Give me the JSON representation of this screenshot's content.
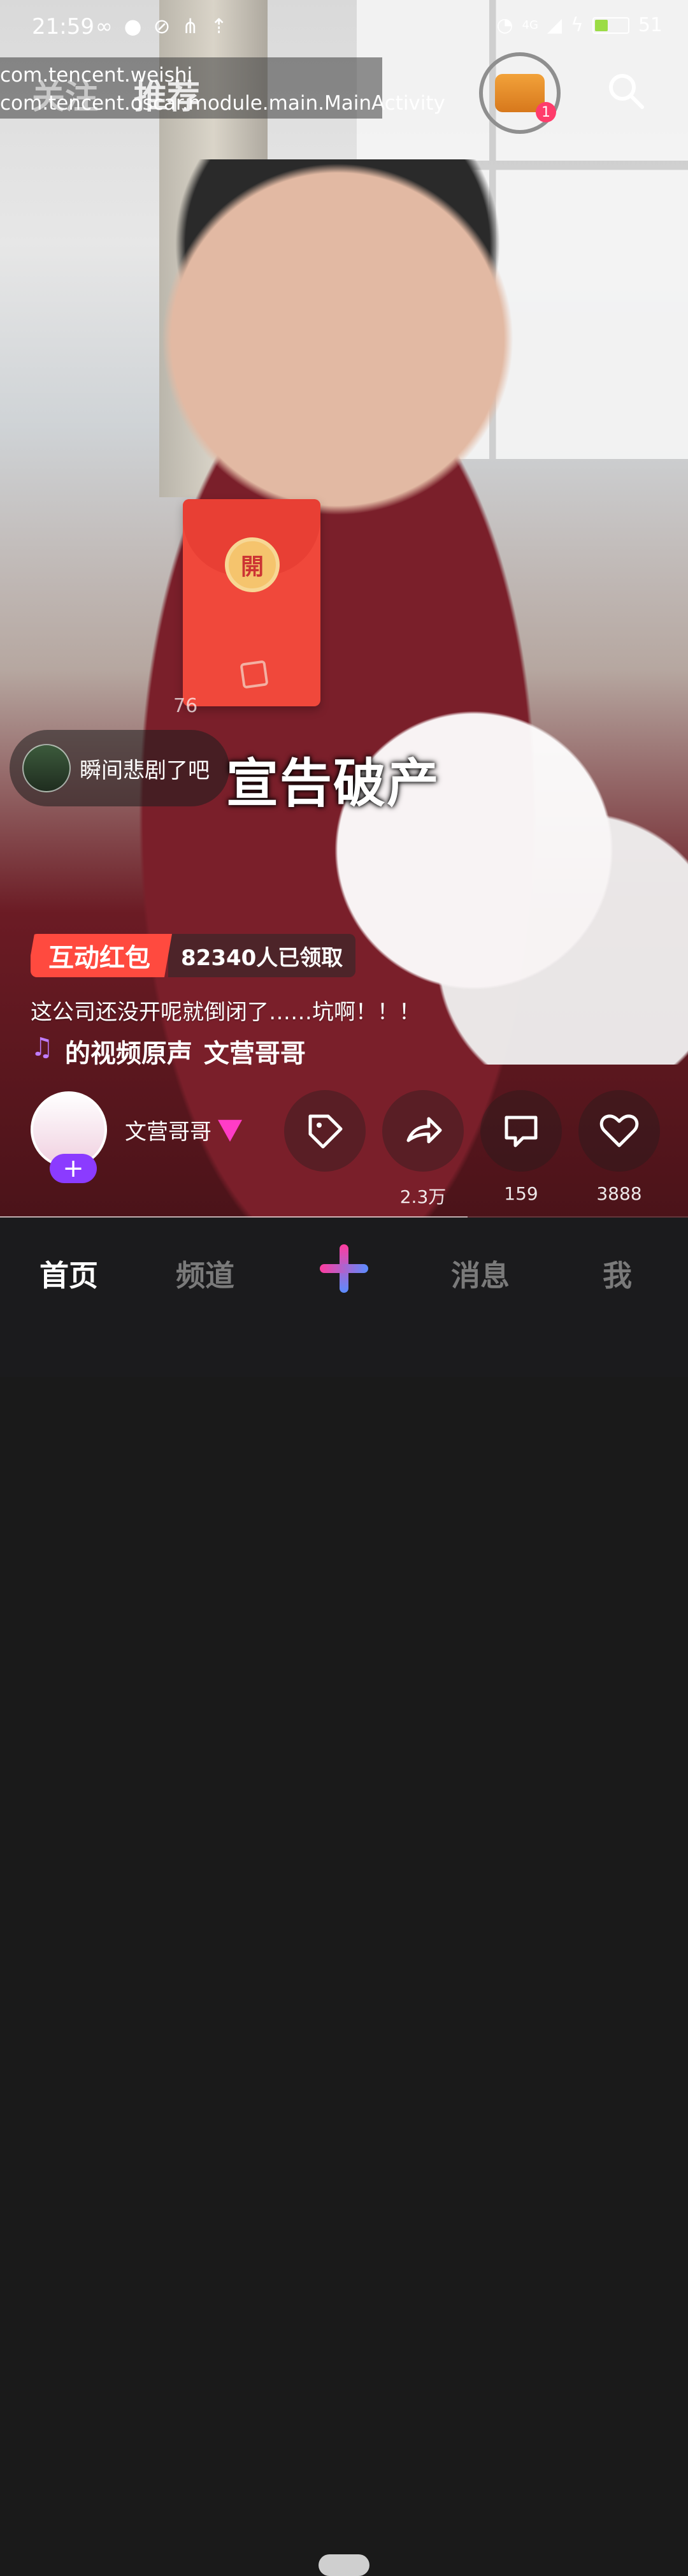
{
  "status": {
    "time": "21:59",
    "battery_level": "51",
    "network": "4G"
  },
  "debug_overlay": {
    "package": "com.tencent.weishi",
    "activity": "com.tencent.oscar.module.main.MainActivity"
  },
  "top_tabs": {
    "follow": "关注",
    "recommend": "推荐"
  },
  "chest_badge": "1",
  "redpack": {
    "open_label": "開",
    "number_below": "76"
  },
  "comment_bubble": {
    "text": "瞬间悲剧了吧"
  },
  "caption": "宣告破产",
  "interactive_redpack": {
    "tag": "互动红包",
    "count_text": "82340人已领取"
  },
  "description": "这公司还没开呢就倒闭了……坑啊！！！",
  "music": {
    "title": "的视频原声",
    "artist": "文营哥哥"
  },
  "author": {
    "name": "文营哥哥",
    "follow_plus": "+"
  },
  "actions": {
    "tag": {
      "count": ""
    },
    "share": {
      "count": "2.3万"
    },
    "comment": {
      "count": "159"
    },
    "like": {
      "count": "3888"
    }
  },
  "bottom_nav": {
    "home": "首页",
    "channel": "频道",
    "messages": "消息",
    "me": "我"
  },
  "video_progress": 0.68
}
